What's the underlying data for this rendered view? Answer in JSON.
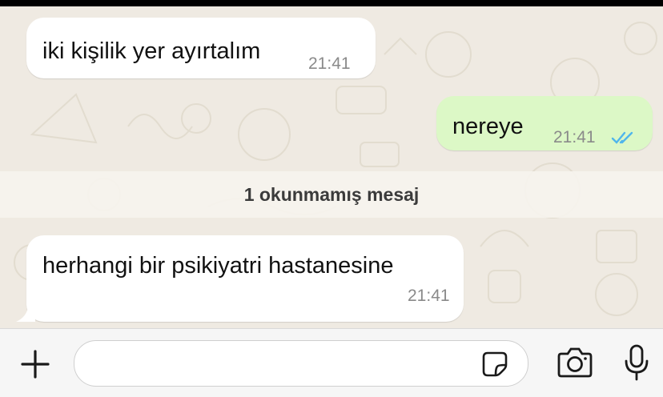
{
  "messages": [
    {
      "direction": "incoming",
      "text": "iki kişilik yer ayırtalım",
      "time": "21:41"
    },
    {
      "direction": "outgoing",
      "text": "nereye",
      "time": "21:41",
      "status": "read"
    },
    {
      "direction": "incoming",
      "text": "herhangi bir psikiyatri hastanesine",
      "time": "21:41"
    }
  ],
  "unread_divider": "1 okunmamış mesaj",
  "input": {
    "value": "",
    "placeholder": ""
  },
  "icons": {
    "add": "plus-icon",
    "sticker": "sticker-icon",
    "camera": "camera-icon",
    "mic": "microphone-icon",
    "read_receipt": "double-check-icon"
  },
  "colors": {
    "chat_background": "#efeae2",
    "incoming_bubble": "#ffffff",
    "outgoing_bubble": "#dcf8c6",
    "read_receipt": "#4fb6ec"
  }
}
